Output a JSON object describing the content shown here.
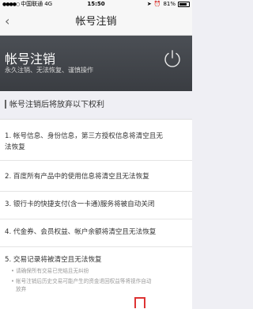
{
  "status_bar": {
    "carrier": "中国联通",
    "network": "4G",
    "time": "15:50",
    "battery": "81%"
  },
  "nav": {
    "back_icon": "chevron-left-icon",
    "title": "帐号注销"
  },
  "hero": {
    "title": "帐号注销",
    "subtitle": "永久注销、无法恢复、谨慎操作",
    "icon": "power-icon"
  },
  "section": {
    "title": "帐号注销后将放弃以下权利"
  },
  "items": [
    {
      "text_line1": "1. 帐号信息、身份信息，第三方授权信息将清空且无",
      "text_line2": "法恢复"
    },
    {
      "text_line1": "2. 百度所有产品中的使用信息将清空且无法恢复"
    },
    {
      "text_line1": "3. 银行卡的快捷支付(含一卡通)服务将被自动关闭"
    },
    {
      "text_line1": "4. 代金券、会员权益、帐户余额将清空且无法恢复"
    },
    {
      "text_line1": "5. 交易记录将被清空且无法恢复",
      "notes": [
        "• 请确保所有交易已完结且无纠纷",
        "• 帐号注销后历史交易可能产生的资金退回权益等将视作自动",
        "放弃"
      ]
    }
  ],
  "colors": {
    "hero_bg": "#3f4348",
    "confirm_accent": "#dd3333"
  }
}
